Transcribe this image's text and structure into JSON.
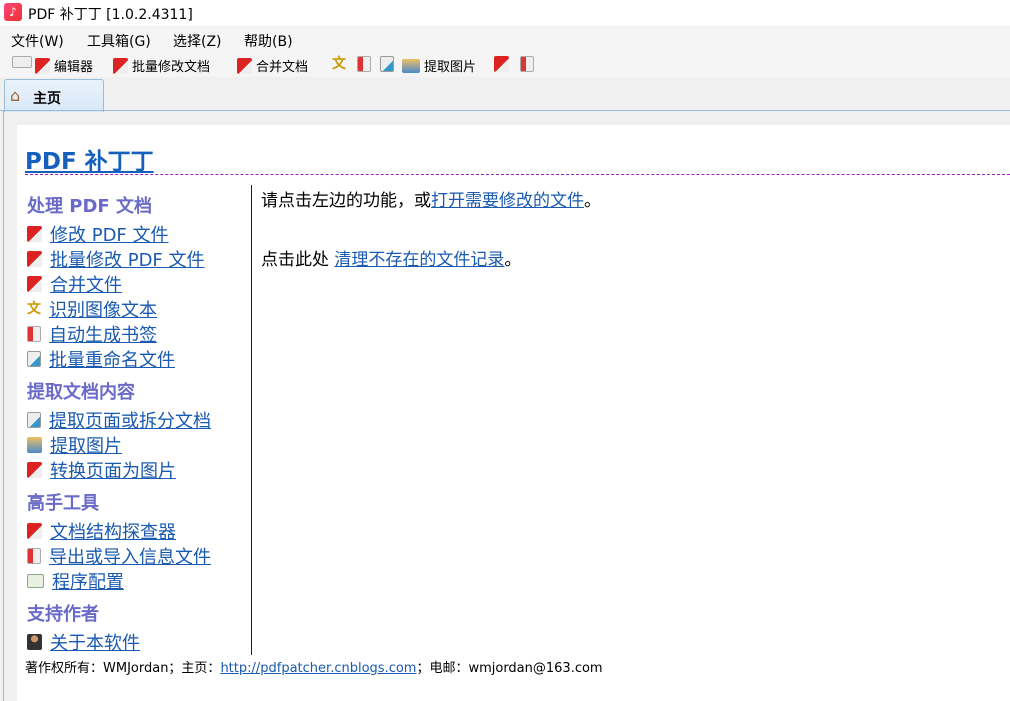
{
  "window": {
    "title": "PDF 补丁丁 [1.0.2.4311]"
  },
  "menu": [
    "文件(W)",
    "工具箱(G)",
    "选择(Z)",
    "帮助(B)"
  ],
  "toolbar": {
    "editor": "编辑器",
    "batch_edit": "批量修改文档",
    "merge": "合并文档",
    "extract_images": "提取图片"
  },
  "tab": {
    "label": "主页"
  },
  "main": {
    "heading": "PDF 补丁丁",
    "sections": [
      {
        "title": "处理 PDF 文档",
        "items": [
          "修改 PDF 文件",
          "批量修改 PDF 文件",
          "合并文件",
          "识别图像文本",
          "自动生成书签",
          "批量重命名文件"
        ]
      },
      {
        "title": "提取文档内容",
        "items": [
          "提取页面或拆分文档",
          "提取图片",
          "转换页面为图片"
        ]
      },
      {
        "title": "高手工具",
        "items": [
          "文档结构探查器",
          "导出或导入信息文件",
          "程序配置"
        ]
      },
      {
        "title": "支持作者",
        "items": [
          "关于本软件"
        ]
      }
    ],
    "line1_prefix": "请点击左边的功能，或",
    "line1_link": "打开需要修改的文件",
    "line1_suffix": "。",
    "line2_prefix": "点击此处 ",
    "line2_link": "清理不存在的文件记录",
    "line2_suffix": "。"
  },
  "footer": {
    "prefix": "著作权所有：WMJordan；主页：",
    "url": "http://pdfpatcher.cnblogs.com",
    "suffix": "；电邮：wmjordan@163.com"
  }
}
